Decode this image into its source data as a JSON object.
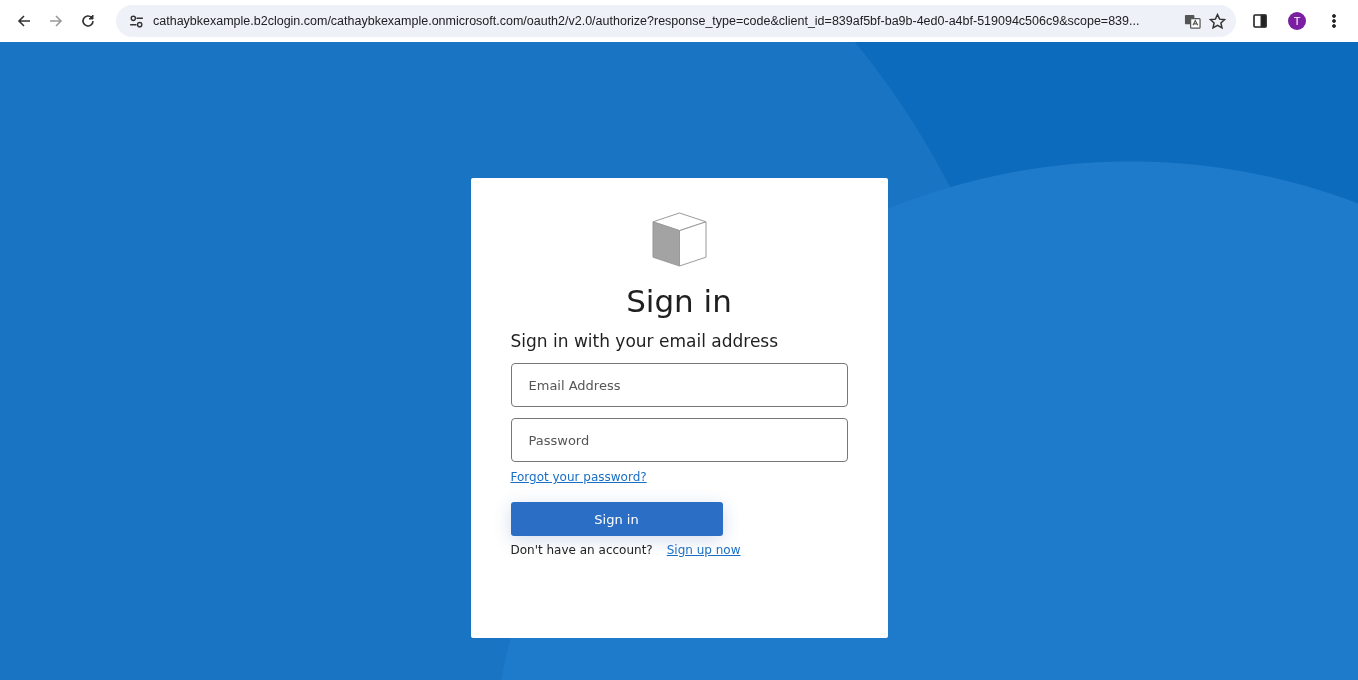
{
  "browser": {
    "url": "cathaybkexample.b2clogin.com/cathaybkexample.onmicrosoft.com/oauth2/v2.0/authorize?response_type=code&client_id=839af5bf-ba9b-4ed0-a4bf-519094c506c9&scope=839...",
    "profile_initial": "T",
    "forward_disabled": true
  },
  "card": {
    "title": "Sign in",
    "subtitle": "Sign in with your email address",
    "fields": [
      {
        "placeholder": "Email Address"
      },
      {
        "placeholder": "Password"
      }
    ],
    "forgot_link": "Forgot your password?",
    "button": "Sign in",
    "signup_prompt": "Don't have an account?",
    "signup_link": "Sign up now"
  }
}
